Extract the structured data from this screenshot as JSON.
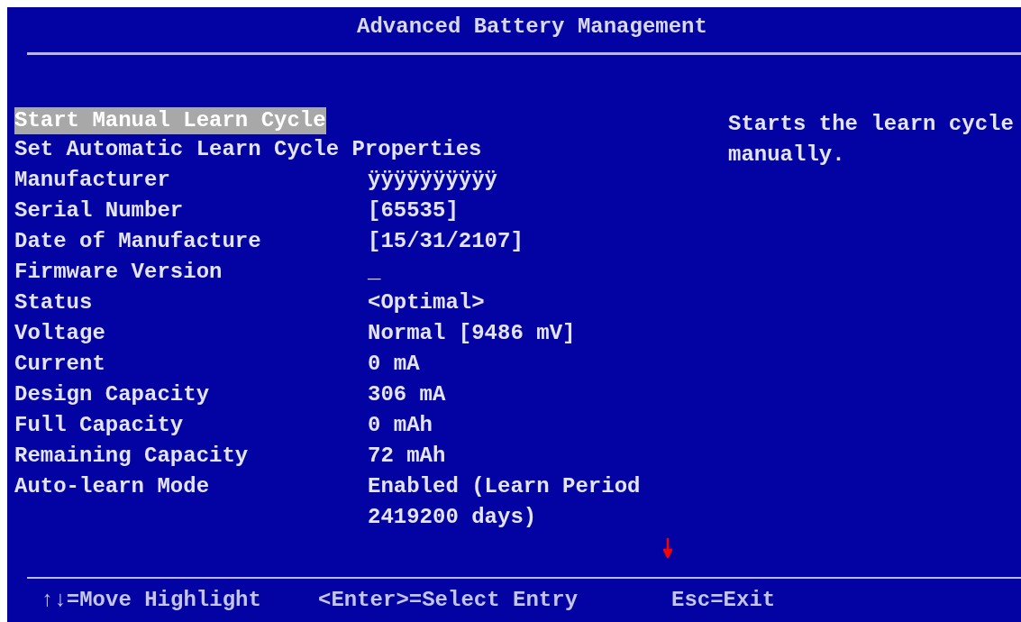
{
  "title": "Advanced Battery Management",
  "items": [
    {
      "label": "Start Manual Learn Cycle",
      "selected": true
    },
    {
      "label": "Set Automatic Learn Cycle Properties",
      "selected": false
    },
    {
      "label": "Manufacturer",
      "value": "ÿÿÿÿÿÿÿÿÿÿ",
      "selected": false
    },
    {
      "label": "Serial Number",
      "value": "[65535]",
      "selected": false
    },
    {
      "label": "Date of Manufacture",
      "value": "[15/31/2107]",
      "selected": false
    },
    {
      "label": "Firmware Version",
      "value": "_",
      "selected": false
    },
    {
      "label": "Status",
      "value": "<Optimal>",
      "selected": false
    },
    {
      "label": "Voltage",
      "value": "Normal [9486 mV]",
      "selected": false
    },
    {
      "label": "Current",
      "value": "0 mA",
      "selected": false
    },
    {
      "label": "Design Capacity",
      "value": "306 mA",
      "selected": false
    },
    {
      "label": "Full Capacity",
      "value": "0 mAh",
      "selected": false
    },
    {
      "label": "Remaining Capacity",
      "value": "72 mAh",
      "selected": false
    },
    {
      "label": "Auto-learn Mode",
      "value": "Enabled (Learn Period 2419200 days)",
      "selected": false
    }
  ],
  "help_text": "Starts the learn cycle manually.",
  "more_below": true,
  "footer": [
    "↑↓=Move Highlight",
    "<Enter>=Select Entry",
    "Esc=Exit"
  ]
}
